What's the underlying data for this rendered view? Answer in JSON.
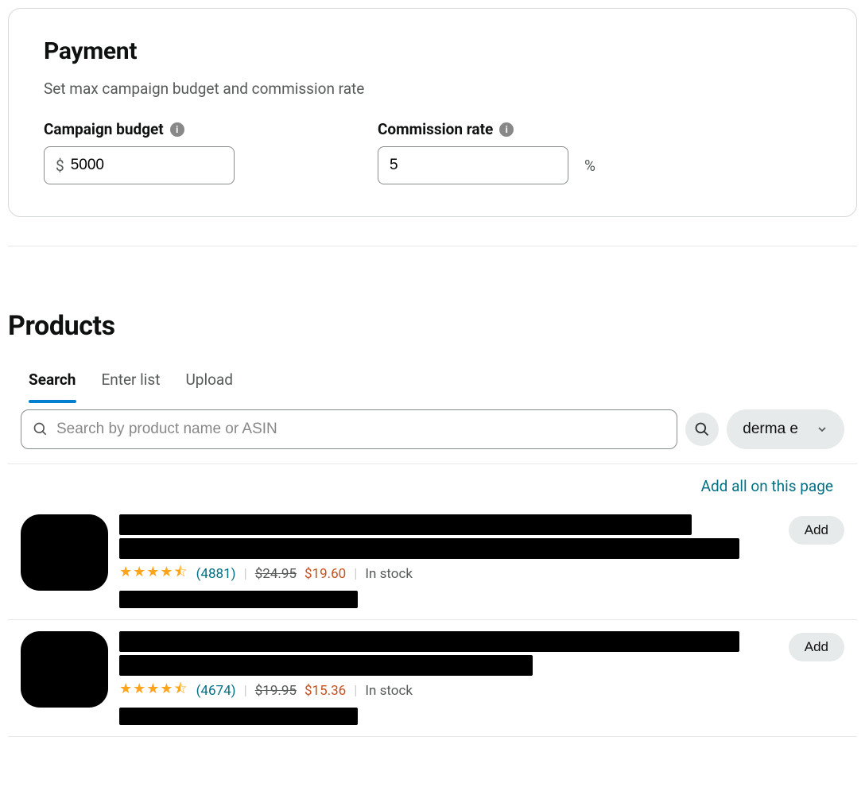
{
  "payment": {
    "title": "Payment",
    "subtitle": "Set max campaign budget and commission rate",
    "budget": {
      "label": "Campaign budget",
      "currency": "$",
      "value": "5000"
    },
    "commission": {
      "label": "Commission rate",
      "value": "5",
      "suffix": "%"
    }
  },
  "products": {
    "title": "Products",
    "tabs": {
      "search": "Search",
      "enter_list": "Enter list",
      "upload": "Upload"
    },
    "search": {
      "placeholder": "Search by product name or ASIN"
    },
    "brand_filter": {
      "selected": "derma e"
    },
    "add_all_label": "Add all on this page",
    "add_label": "Add",
    "items": [
      {
        "review_count": "(4881)",
        "old_price": "$24.95",
        "new_price": "$19.60",
        "stock": "In stock"
      },
      {
        "review_count": "(4674)",
        "old_price": "$19.95",
        "new_price": "$15.36",
        "stock": "In stock"
      }
    ]
  }
}
